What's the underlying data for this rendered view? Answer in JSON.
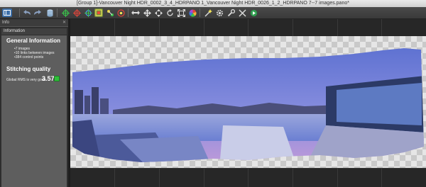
{
  "window": {
    "title": "[Group 1]-Vancouver Night HDR_0002_3_4_HDRPANO 1_Vancouver Night HDR_0026_1_2_HDRPANO 7--7 images.pano*"
  },
  "toolbar": {
    "buttons": [
      {
        "icon": "layout-icon"
      },
      {
        "icon": "undo-icon"
      },
      {
        "icon": "redo-icon"
      },
      {
        "icon": "cylinder-icon"
      },
      {
        "icon": "crosshair-green-icon"
      },
      {
        "icon": "crosshair-red-icon"
      },
      {
        "icon": "crosshair-blue-icon"
      },
      {
        "icon": "crop-icon"
      },
      {
        "icon": "control-points-icon"
      },
      {
        "icon": "optimize-icon"
      },
      {
        "icon": "arrows-horizontal-icon"
      },
      {
        "icon": "move-arrows-icon"
      },
      {
        "icon": "pan-arrows-icon"
      },
      {
        "icon": "rotate-arrows-icon"
      },
      {
        "icon": "expand-icon"
      },
      {
        "icon": "color-wheel-icon"
      },
      {
        "icon": "wand-icon"
      },
      {
        "icon": "gear-icon"
      },
      {
        "icon": "wrench-icon"
      },
      {
        "icon": "tools-icon"
      },
      {
        "icon": "render-icon"
      }
    ]
  },
  "side_panel": {
    "header_label": "Info",
    "section_label": "Information",
    "general_title": "General Information",
    "general_items": [
      "7 images",
      "10 links between images",
      "384 control points"
    ],
    "quality_title": "Stitching quality",
    "rms_label": "Global RMS is very good",
    "rms_value": "3.57",
    "status_color": "#2fbf3a"
  }
}
